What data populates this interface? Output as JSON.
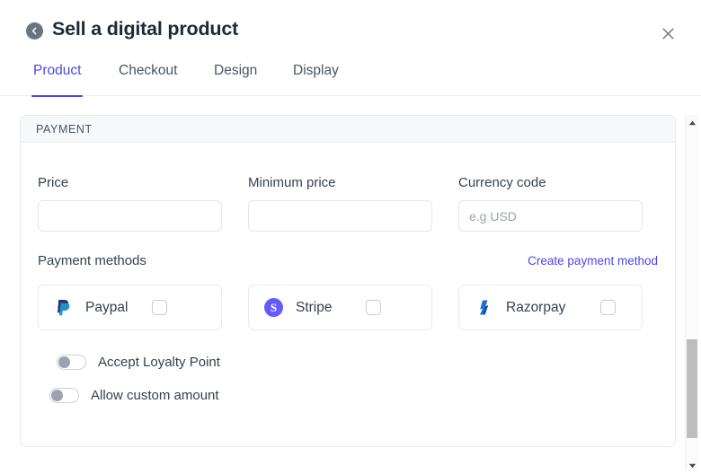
{
  "header": {
    "title": "Sell a digital product",
    "back_icon": "chevron-left-circle-icon",
    "close_icon": "close-icon"
  },
  "tabs": [
    {
      "label": "Product",
      "active": true
    },
    {
      "label": "Checkout",
      "active": false
    },
    {
      "label": "Design",
      "active": false
    },
    {
      "label": "Display",
      "active": false
    }
  ],
  "panel": {
    "section_title": "PAYMENT",
    "fields": [
      {
        "label": "Price",
        "value": "",
        "placeholder": ""
      },
      {
        "label": "Minimum price",
        "value": "",
        "placeholder": ""
      },
      {
        "label": "Currency code",
        "value": "",
        "placeholder": "e.g USD"
      }
    ],
    "payment_methods": {
      "title": "Payment methods",
      "create_link": "Create payment method",
      "items": [
        {
          "label": "Paypal",
          "icon": "paypal-logo-icon",
          "checked": false
        },
        {
          "label": "Stripe",
          "icon": "stripe-logo-icon",
          "checked": false
        },
        {
          "label": "Razorpay",
          "icon": "razorpay-logo-icon",
          "checked": false
        }
      ]
    },
    "toggles": [
      {
        "label": "Accept Loyalty Point",
        "on": false
      },
      {
        "label": "Allow custom amount",
        "on": false
      }
    ]
  },
  "scrollbar": {
    "up_icon": "triangle-up-icon",
    "down_icon": "triangle-down-icon"
  },
  "colors": {
    "accent": "#4f46e5",
    "paypal": "#1e4b9c",
    "stripe": "#635bff",
    "razorpay": "#0c6fd4",
    "text": "#374151",
    "muted": "#9ca3af"
  }
}
